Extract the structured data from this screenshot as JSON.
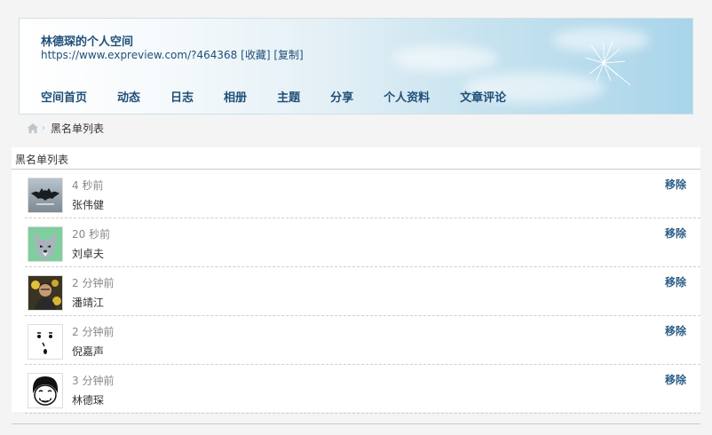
{
  "header": {
    "title": "林德琛的个人空间",
    "url": "https://www.expreview.com/?464368",
    "favorite_label": "[收藏]",
    "copy_label": "[复制]"
  },
  "nav": [
    {
      "label": "空间首页"
    },
    {
      "label": "动态"
    },
    {
      "label": "日志"
    },
    {
      "label": "相册"
    },
    {
      "label": "主题"
    },
    {
      "label": "分享"
    },
    {
      "label": "个人资料"
    },
    {
      "label": "文章评论"
    }
  ],
  "breadcrumb": {
    "icon": "home-icon",
    "current": "黑名单列表"
  },
  "panel": {
    "title": "黑名单列表",
    "remove_label": "移除",
    "rows": [
      {
        "time": "4 秒前",
        "name": "张伟健",
        "avatar": "batman-logo"
      },
      {
        "time": "20 秒前",
        "name": "刘卓夫",
        "avatar": "wolf-cartoon"
      },
      {
        "time": "2 分钟前",
        "name": "潘靖江",
        "avatar": "person-photo"
      },
      {
        "time": "2 分钟前",
        "name": "倪嘉声",
        "avatar": "drawn-face"
      },
      {
        "time": "3 分钟前",
        "name": "林德琛",
        "avatar": "meme-face"
      }
    ]
  },
  "colors": {
    "link": "#1f4f78",
    "remove": "#2b5c88",
    "banner_sky": "#a9d5ea"
  }
}
